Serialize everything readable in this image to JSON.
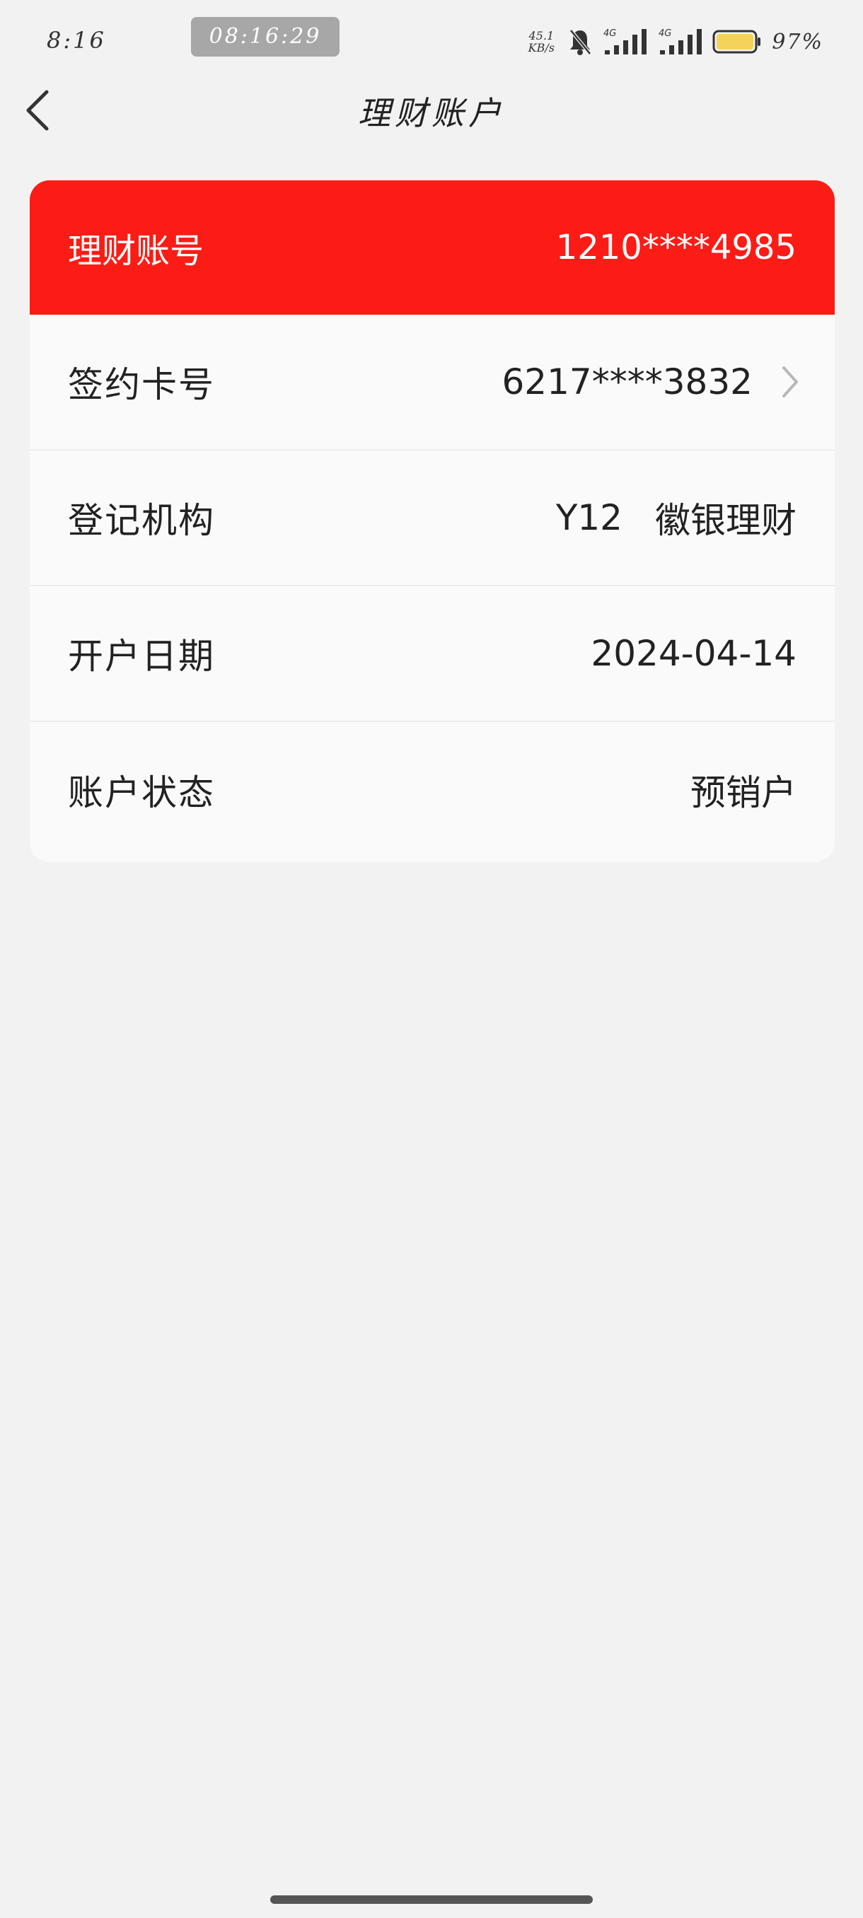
{
  "status_bar": {
    "time": "8:16",
    "clock_pill": "08:16:29",
    "net_speed_value": "45.1",
    "net_speed_unit": "KB/s",
    "network_1": "4G",
    "network_2": "4G",
    "battery_percent": "97%",
    "battery_color": "#f5d35a"
  },
  "nav": {
    "title": "理财账户"
  },
  "account": {
    "header_label": "理财账号",
    "header_value": "1210****4985",
    "header_color": "#fc1c16",
    "rows": [
      {
        "label": "签约卡号",
        "value": "6217****3832"
      },
      {
        "label": "登记机构",
        "value_code": "Y12",
        "value_name": "徽银理财"
      },
      {
        "label": "开户日期",
        "value": "2024-04-14"
      },
      {
        "label": "账户状态",
        "value": "预销户"
      }
    ]
  }
}
